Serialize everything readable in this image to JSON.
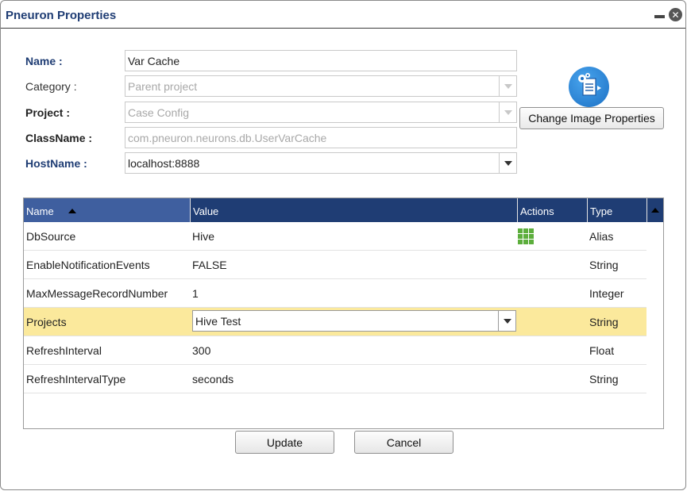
{
  "dialog": {
    "title": "Pneuron Properties"
  },
  "form": {
    "name_label": "Name :",
    "name_value": "Var Cache",
    "category_label": "Category :",
    "category_value": "Parent project",
    "project_label": "Project :",
    "project_value": "Case Config",
    "classname_label": "ClassName :",
    "classname_value": "com.pneuron.neurons.db.UserVarCache",
    "hostname_label": "HostName :",
    "hostname_value": "localhost:8888"
  },
  "image": {
    "icon": "image-properties-icon",
    "button_label": "Change Image Properties"
  },
  "grid": {
    "columns": [
      "Name",
      "Value",
      "Actions",
      "Type"
    ],
    "rows": [
      {
        "name": "DbSource",
        "value": "Hive",
        "type": "Alias"
      },
      {
        "name": "EnableNotificationEvents",
        "value": "FALSE",
        "type": "String"
      },
      {
        "name": "MaxMessageRecordNumber",
        "value": "1",
        "type": "Integer"
      },
      {
        "name": "Projects",
        "value": "Hive Test",
        "type": "String"
      },
      {
        "name": "RefreshInterval",
        "value": "300",
        "type": "Float"
      },
      {
        "name": "RefreshIntervalType",
        "value": "seconds",
        "type": "String"
      }
    ]
  },
  "buttons": {
    "update": "Update",
    "cancel": "Cancel"
  },
  "colors": {
    "title": "#1f3d74",
    "header": "#1f3d74",
    "selected_row": "#fbe99c"
  }
}
